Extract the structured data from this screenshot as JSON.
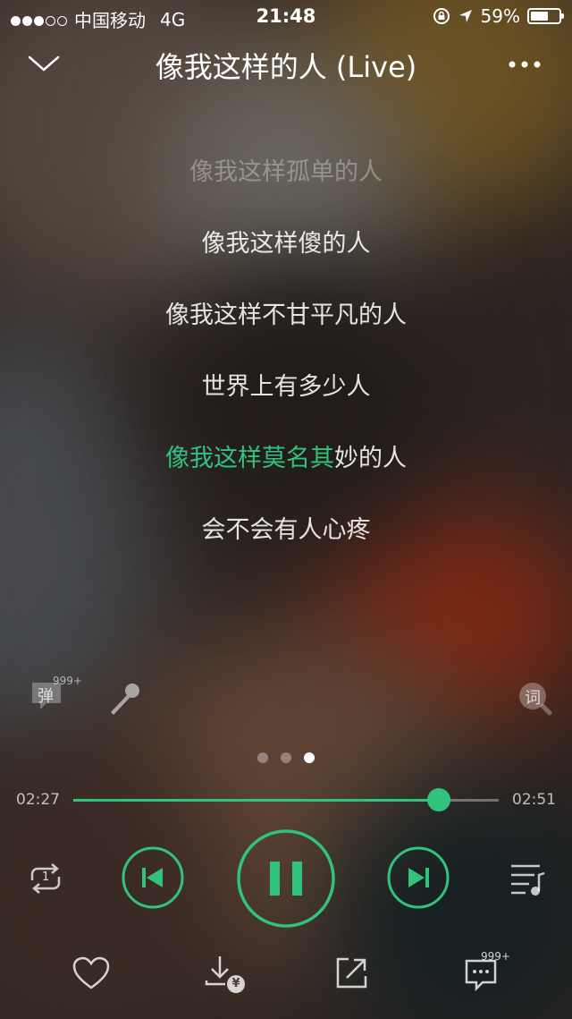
{
  "status_bar": {
    "carrier": "中国移动",
    "network": "4G",
    "time": "21:48",
    "battery": "59%",
    "battery_level": 0.59
  },
  "header": {
    "title": "像我这样的人 (Live)",
    "collapse_icon": "chevron-down-icon",
    "more_icon": "more-dots-icon"
  },
  "lyrics": {
    "lines": [
      "像我这样孤单的人",
      "像我这样傻的人",
      "像我这样不甘平凡的人",
      "世界上有多少人",
      "像我这样莫名其妙的人",
      "会不会有人心疼"
    ],
    "current_sung": "像我这样莫名其",
    "current_rest": "妙的人",
    "highlight_color": "#31c27c"
  },
  "tools": {
    "danmaku_label": "弹",
    "danmaku_count": "999+",
    "lyrics_label": "词"
  },
  "pager": {
    "count": 3,
    "active": 3
  },
  "progress": {
    "current": "02:27",
    "total": "02:51",
    "fraction": 0.86
  },
  "controls": {
    "repeat_icon": "repeat-one-icon",
    "repeat_num": "1",
    "prev_icon": "skip-previous-icon",
    "pause_icon": "pause-icon",
    "next_icon": "skip-next-icon",
    "playlist_icon": "playlist-icon"
  },
  "bottom": {
    "comments_count": "999+",
    "download_price": "¥"
  }
}
